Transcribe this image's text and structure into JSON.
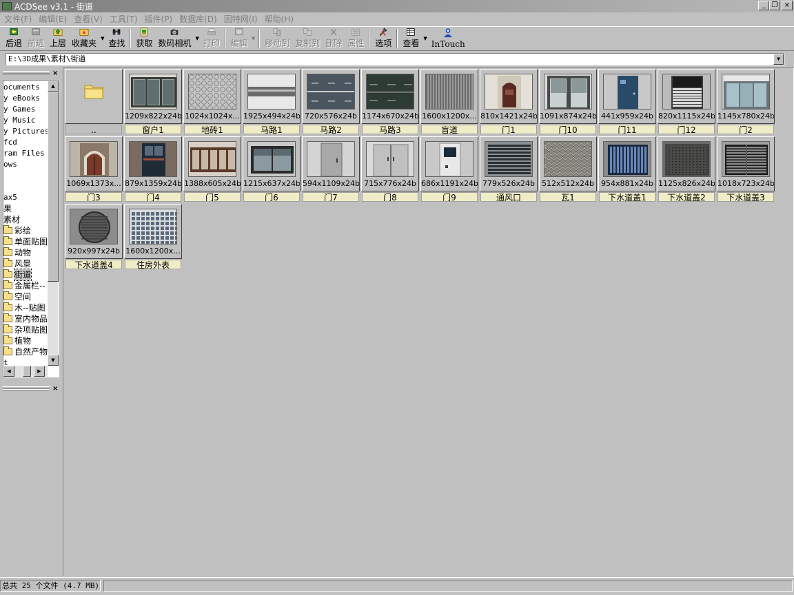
{
  "window": {
    "title": "ACDSee v3.1 - 街道",
    "minimize": "_",
    "maximize": "❐",
    "close": "×"
  },
  "menu": [
    {
      "label": "文件(F)"
    },
    {
      "label": "编辑(E)"
    },
    {
      "label": "查看(V)"
    },
    {
      "label": "工具(T)"
    },
    {
      "label": "插件(P)"
    },
    {
      "label": "数据库(D)"
    },
    {
      "label": "因特网(I)"
    },
    {
      "label": "帮助(H)"
    }
  ],
  "toolbar": {
    "back": "后退",
    "forward": "前进",
    "up": "上层",
    "favorites": "收藏夹",
    "find": "查找",
    "acquire": "获取",
    "camera": "数码相机",
    "print": "打印",
    "edit": "编辑",
    "move": "移动到",
    "copy": "复制到",
    "delete": "删除",
    "properties": "属性",
    "options": "选项",
    "view": "查看",
    "intouch": "InTouch"
  },
  "address": {
    "path": "E:\\3D成果\\素材\\街道"
  },
  "tree": {
    "items": [
      {
        "label": "ocuments",
        "folder": false,
        "cn": false,
        "selected": false
      },
      {
        "label": "y eBooks",
        "folder": false,
        "cn": false,
        "selected": false
      },
      {
        "label": "y Games",
        "folder": false,
        "cn": false,
        "selected": false
      },
      {
        "label": "y Music",
        "folder": false,
        "cn": false,
        "selected": false
      },
      {
        "label": "y Pictures",
        "folder": false,
        "cn": false,
        "selected": false
      },
      {
        "label": "fcd",
        "folder": false,
        "cn": false,
        "selected": false
      },
      {
        "label": "ram Files",
        "folder": false,
        "cn": false,
        "selected": false
      },
      {
        "label": "ows",
        "folder": false,
        "cn": false,
        "selected": false
      },
      {
        "label": "",
        "folder": false,
        "cn": false,
        "selected": false
      },
      {
        "label": "",
        "folder": false,
        "cn": false,
        "selected": false
      },
      {
        "label": "ax5",
        "folder": false,
        "cn": false,
        "selected": false
      },
      {
        "label": "果",
        "folder": false,
        "cn": true,
        "selected": false
      },
      {
        "label": "素材",
        "folder": false,
        "cn": true,
        "selected": false
      },
      {
        "label": "彩绘",
        "folder": true,
        "cn": true,
        "selected": false
      },
      {
        "label": "单面贴图",
        "folder": true,
        "cn": true,
        "selected": false
      },
      {
        "label": "动物",
        "folder": true,
        "cn": true,
        "selected": false
      },
      {
        "label": "风景",
        "folder": true,
        "cn": true,
        "selected": false
      },
      {
        "label": "街道",
        "folder": true,
        "cn": true,
        "selected": true
      },
      {
        "label": "金属栏--",
        "folder": true,
        "cn": true,
        "selected": false
      },
      {
        "label": "空间",
        "folder": true,
        "cn": true,
        "selected": false
      },
      {
        "label": "木--贴图",
        "folder": true,
        "cn": true,
        "selected": false
      },
      {
        "label": "室内物品",
        "folder": true,
        "cn": true,
        "selected": false
      },
      {
        "label": "杂项贴图",
        "folder": true,
        "cn": true,
        "selected": false
      },
      {
        "label": "植物",
        "folder": true,
        "cn": true,
        "selected": false
      },
      {
        "label": "自然产物",
        "folder": true,
        "cn": true,
        "selected": false
      },
      {
        "label": "t",
        "folder": false,
        "cn": false,
        "selected": false
      }
    ]
  },
  "thumbnails": [
    {
      "info": "",
      "name": "..",
      "kind": "folder"
    },
    {
      "info": "1209x822x24b",
      "name": "窗户1",
      "kind": "window"
    },
    {
      "info": "1024x1024x...",
      "name": "地砖1",
      "kind": "tile"
    },
    {
      "info": "1925x494x24b",
      "name": "马路1",
      "kind": "road1"
    },
    {
      "info": "720x576x24b",
      "name": "马路2",
      "kind": "road2"
    },
    {
      "info": "1174x670x24b",
      "name": "马路3",
      "kind": "road3"
    },
    {
      "info": "1600x1200x...",
      "name": "盲道",
      "kind": "stripes"
    },
    {
      "info": "810x1421x24b",
      "name": "门1",
      "kind": "door-arch"
    },
    {
      "info": "1091x874x24b",
      "name": "门10",
      "kind": "glassdoor"
    },
    {
      "info": "441x959x24b",
      "name": "门11",
      "kind": "bluedoor"
    },
    {
      "info": "820x1115x24b",
      "name": "门12",
      "kind": "garage"
    },
    {
      "info": "1145x780x24b",
      "name": "门2",
      "kind": "storefront"
    },
    {
      "info": "1069x1373x...",
      "name": "门3",
      "kind": "door-arch2"
    },
    {
      "info": "879x1359x24b",
      "name": "门4",
      "kind": "door-dark"
    },
    {
      "info": "1388x605x24b",
      "name": "门5",
      "kind": "shopfront"
    },
    {
      "info": "1215x637x24b",
      "name": "门6",
      "kind": "window2"
    },
    {
      "info": "594x1109x24b",
      "name": "门7",
      "kind": "greydoor"
    },
    {
      "info": "715x776x24b",
      "name": "门8",
      "kind": "doubledoor"
    },
    {
      "info": "686x1191x24b",
      "name": "门9",
      "kind": "whitedoor"
    },
    {
      "info": "779x526x24b",
      "name": "通风口",
      "kind": "vent"
    },
    {
      "info": "512x512x24b",
      "name": "瓦1",
      "kind": "scale"
    },
    {
      "info": "954x881x24b",
      "name": "下水道盖1",
      "kind": "grate-blue"
    },
    {
      "info": "1125x826x24b",
      "name": "下水道盖2",
      "kind": "grate-plate"
    },
    {
      "info": "1018x723x24b",
      "name": "下水道盖3",
      "kind": "grate-bars"
    },
    {
      "info": "920x997x24b",
      "name": "下水道盖4",
      "kind": "manhole"
    },
    {
      "info": "1600x1200x...",
      "name": "住房外表",
      "kind": "building"
    }
  ],
  "status": {
    "summary": "总共 25 个文件 (4.7 MB)"
  }
}
